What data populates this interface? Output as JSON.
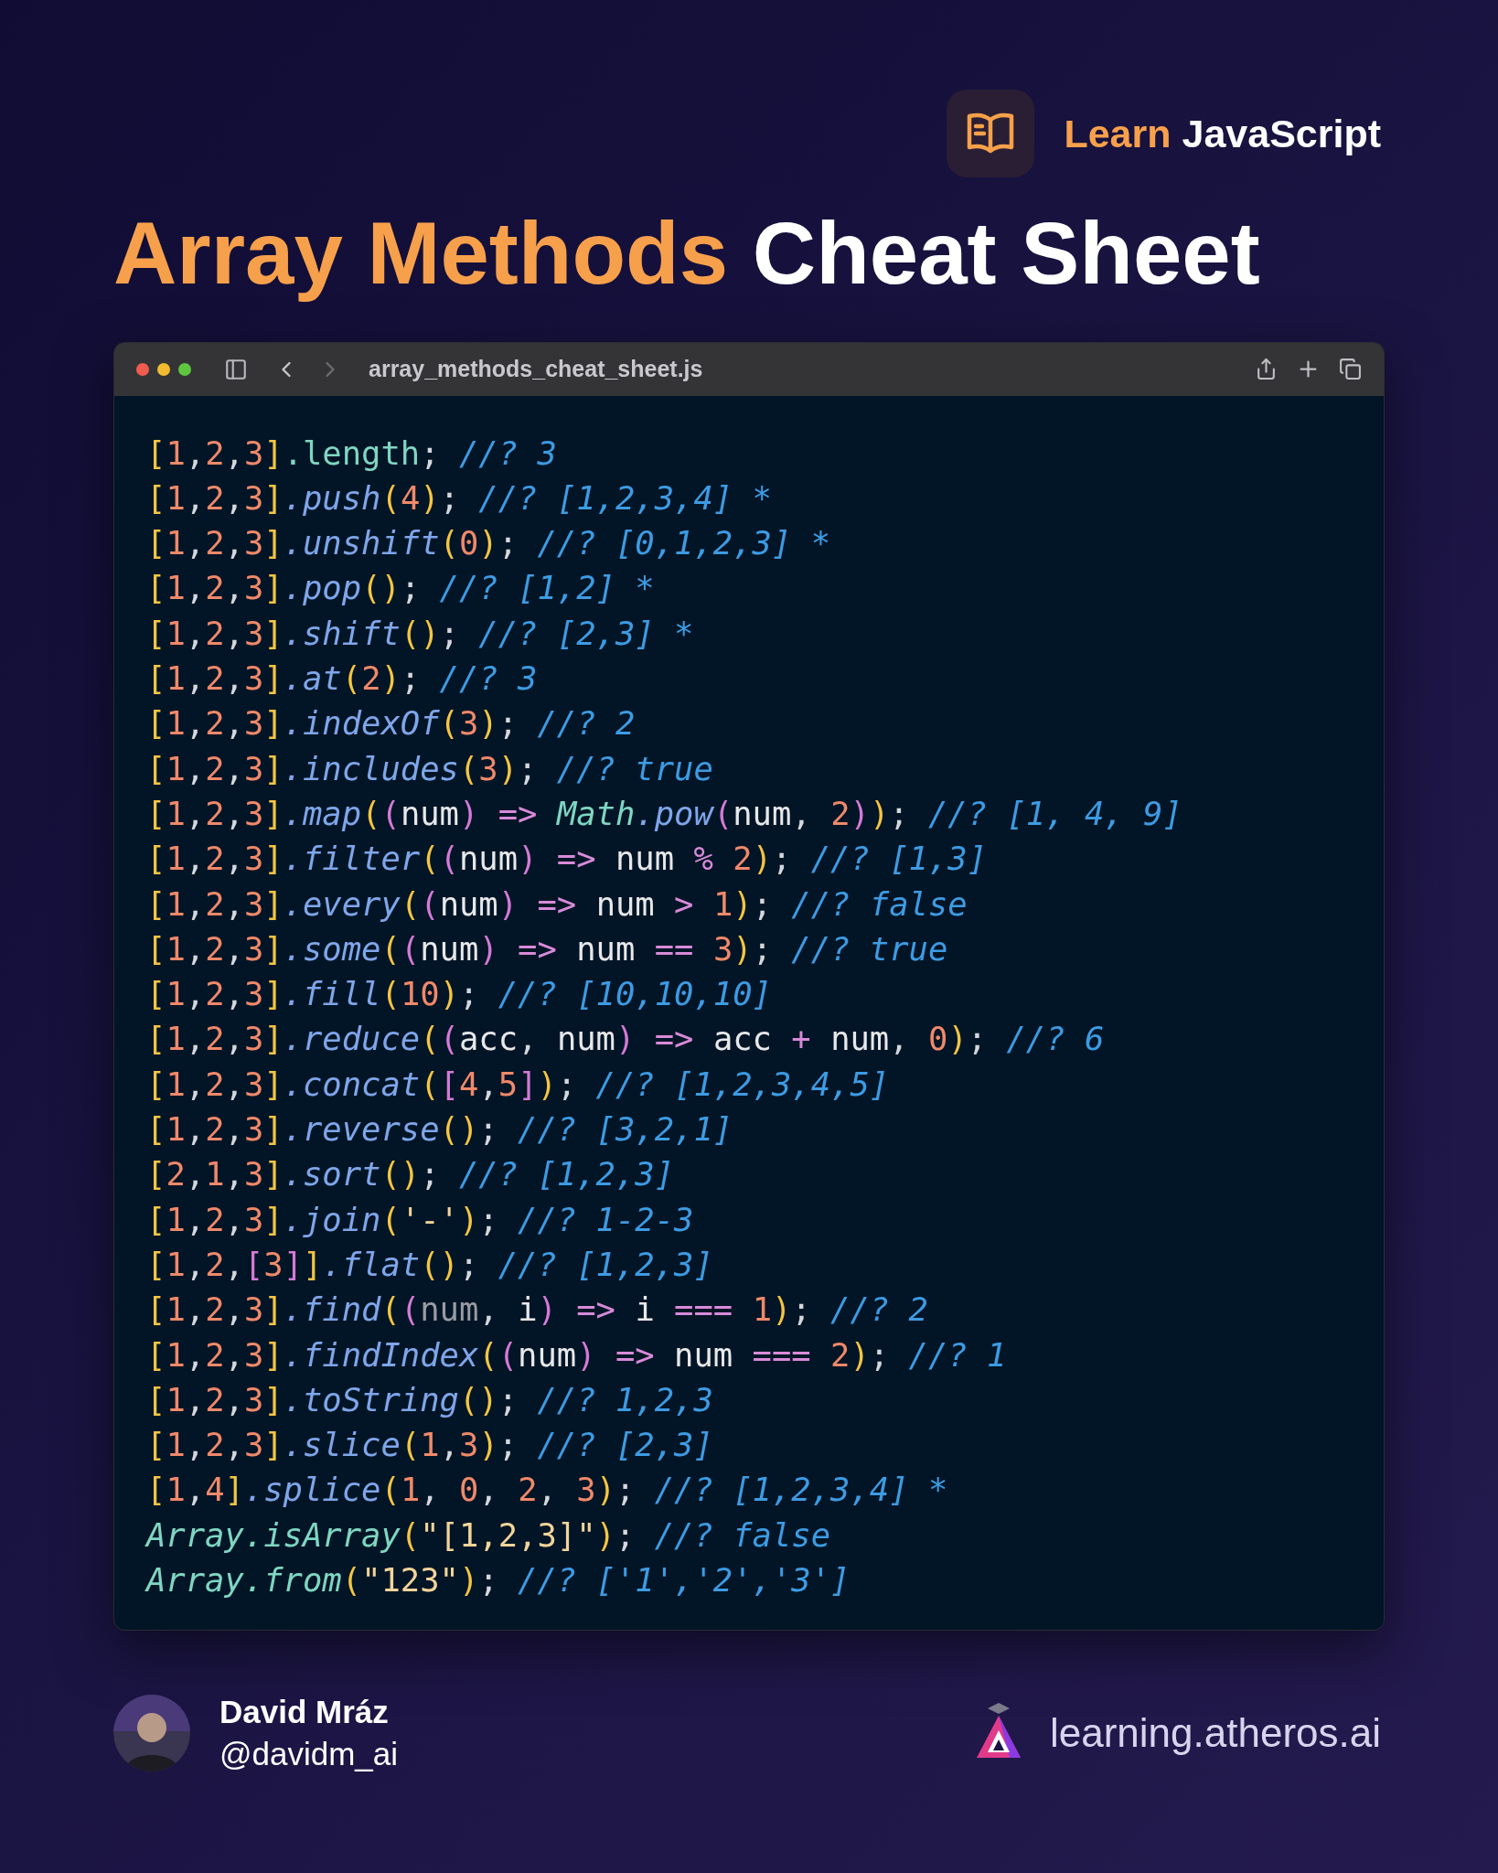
{
  "brand": {
    "highlight": "Learn",
    "rest": "JavaScript"
  },
  "title": {
    "highlight": "Array Methods",
    "rest": "Cheat Sheet"
  },
  "window": {
    "title": "array_methods_cheat_sheet.js"
  },
  "code_lines": [
    [
      {
        "text": "[",
        "kind": "br"
      },
      {
        "text": "1",
        "kind": "num"
      },
      {
        "text": ",",
        "kind": "p"
      },
      {
        "text": "2",
        "kind": "num"
      },
      {
        "text": ",",
        "kind": "p"
      },
      {
        "text": "3",
        "kind": "num"
      },
      {
        "text": "]",
        "kind": "br"
      },
      {
        "text": ".length",
        "kind": "prop"
      },
      {
        "text": ";",
        "kind": "p"
      },
      {
        "text": " //? 3",
        "kind": "c"
      }
    ],
    [
      {
        "text": "[",
        "kind": "br"
      },
      {
        "text": "1",
        "kind": "num"
      },
      {
        "text": ",",
        "kind": "p"
      },
      {
        "text": "2",
        "kind": "num"
      },
      {
        "text": ",",
        "kind": "p"
      },
      {
        "text": "3",
        "kind": "num"
      },
      {
        "text": "]",
        "kind": "br"
      },
      {
        "text": ".push",
        "kind": "m"
      },
      {
        "text": "(",
        "kind": "br"
      },
      {
        "text": "4",
        "kind": "num"
      },
      {
        "text": ")",
        "kind": "br"
      },
      {
        "text": ";",
        "kind": "p"
      },
      {
        "text": " //? [1,2,3,4] *",
        "kind": "c"
      }
    ],
    [
      {
        "text": "[",
        "kind": "br"
      },
      {
        "text": "1",
        "kind": "num"
      },
      {
        "text": ",",
        "kind": "p"
      },
      {
        "text": "2",
        "kind": "num"
      },
      {
        "text": ",",
        "kind": "p"
      },
      {
        "text": "3",
        "kind": "num"
      },
      {
        "text": "]",
        "kind": "br"
      },
      {
        "text": ".unshift",
        "kind": "m"
      },
      {
        "text": "(",
        "kind": "br"
      },
      {
        "text": "0",
        "kind": "num"
      },
      {
        "text": ")",
        "kind": "br"
      },
      {
        "text": ";",
        "kind": "p"
      },
      {
        "text": " //? [0,1,2,3] *",
        "kind": "c"
      }
    ],
    [
      {
        "text": "[",
        "kind": "br"
      },
      {
        "text": "1",
        "kind": "num"
      },
      {
        "text": ",",
        "kind": "p"
      },
      {
        "text": "2",
        "kind": "num"
      },
      {
        "text": ",",
        "kind": "p"
      },
      {
        "text": "3",
        "kind": "num"
      },
      {
        "text": "]",
        "kind": "br"
      },
      {
        "text": ".pop",
        "kind": "m"
      },
      {
        "text": "()",
        "kind": "br"
      },
      {
        "text": ";",
        "kind": "p"
      },
      {
        "text": " //? [1,2] *",
        "kind": "c"
      }
    ],
    [
      {
        "text": "[",
        "kind": "br"
      },
      {
        "text": "1",
        "kind": "num"
      },
      {
        "text": ",",
        "kind": "p"
      },
      {
        "text": "2",
        "kind": "num"
      },
      {
        "text": ",",
        "kind": "p"
      },
      {
        "text": "3",
        "kind": "num"
      },
      {
        "text": "]",
        "kind": "br"
      },
      {
        "text": ".shift",
        "kind": "m"
      },
      {
        "text": "()",
        "kind": "br"
      },
      {
        "text": ";",
        "kind": "p"
      },
      {
        "text": " //? [2,3] *",
        "kind": "c"
      }
    ],
    [
      {
        "text": "[",
        "kind": "br"
      },
      {
        "text": "1",
        "kind": "num"
      },
      {
        "text": ",",
        "kind": "p"
      },
      {
        "text": "2",
        "kind": "num"
      },
      {
        "text": ",",
        "kind": "p"
      },
      {
        "text": "3",
        "kind": "num"
      },
      {
        "text": "]",
        "kind": "br"
      },
      {
        "text": ".at",
        "kind": "m"
      },
      {
        "text": "(",
        "kind": "br"
      },
      {
        "text": "2",
        "kind": "num"
      },
      {
        "text": ")",
        "kind": "br"
      },
      {
        "text": ";",
        "kind": "p"
      },
      {
        "text": " //? 3",
        "kind": "c"
      }
    ],
    [
      {
        "text": "[",
        "kind": "br"
      },
      {
        "text": "1",
        "kind": "num"
      },
      {
        "text": ",",
        "kind": "p"
      },
      {
        "text": "2",
        "kind": "num"
      },
      {
        "text": ",",
        "kind": "p"
      },
      {
        "text": "3",
        "kind": "num"
      },
      {
        "text": "]",
        "kind": "br"
      },
      {
        "text": ".indexOf",
        "kind": "m"
      },
      {
        "text": "(",
        "kind": "br"
      },
      {
        "text": "3",
        "kind": "num"
      },
      {
        "text": ")",
        "kind": "br"
      },
      {
        "text": ";",
        "kind": "p"
      },
      {
        "text": " //? 2",
        "kind": "c"
      }
    ],
    [
      {
        "text": "[",
        "kind": "br"
      },
      {
        "text": "1",
        "kind": "num"
      },
      {
        "text": ",",
        "kind": "p"
      },
      {
        "text": "2",
        "kind": "num"
      },
      {
        "text": ",",
        "kind": "p"
      },
      {
        "text": "3",
        "kind": "num"
      },
      {
        "text": "]",
        "kind": "br"
      },
      {
        "text": ".includes",
        "kind": "m"
      },
      {
        "text": "(",
        "kind": "br"
      },
      {
        "text": "3",
        "kind": "num"
      },
      {
        "text": ")",
        "kind": "br"
      },
      {
        "text": ";",
        "kind": "p"
      },
      {
        "text": " //? true",
        "kind": "c"
      }
    ],
    [
      {
        "text": "[",
        "kind": "br"
      },
      {
        "text": "1",
        "kind": "num"
      },
      {
        "text": ",",
        "kind": "p"
      },
      {
        "text": "2",
        "kind": "num"
      },
      {
        "text": ",",
        "kind": "p"
      },
      {
        "text": "3",
        "kind": "num"
      },
      {
        "text": "]",
        "kind": "br"
      },
      {
        "text": ".map",
        "kind": "m"
      },
      {
        "text": "(",
        "kind": "br"
      },
      {
        "text": "(",
        "kind": "pp"
      },
      {
        "text": "num",
        "kind": "id"
      },
      {
        "text": ")",
        "kind": "pp"
      },
      {
        "text": " => ",
        "kind": "op"
      },
      {
        "text": "Math",
        "kind": "cls"
      },
      {
        "text": ".pow",
        "kind": "m"
      },
      {
        "text": "(",
        "kind": "pp"
      },
      {
        "text": "num",
        "kind": "id"
      },
      {
        "text": ", ",
        "kind": "p"
      },
      {
        "text": "2",
        "kind": "num"
      },
      {
        "text": ")",
        "kind": "pp"
      },
      {
        "text": ")",
        "kind": "br"
      },
      {
        "text": ";",
        "kind": "p"
      },
      {
        "text": " //? [1, 4, 9]",
        "kind": "c"
      }
    ],
    [
      {
        "text": "[",
        "kind": "br"
      },
      {
        "text": "1",
        "kind": "num"
      },
      {
        "text": ",",
        "kind": "p"
      },
      {
        "text": "2",
        "kind": "num"
      },
      {
        "text": ",",
        "kind": "p"
      },
      {
        "text": "3",
        "kind": "num"
      },
      {
        "text": "]",
        "kind": "br"
      },
      {
        "text": ".filter",
        "kind": "m"
      },
      {
        "text": "(",
        "kind": "br"
      },
      {
        "text": "(",
        "kind": "pp"
      },
      {
        "text": "num",
        "kind": "id"
      },
      {
        "text": ")",
        "kind": "pp"
      },
      {
        "text": " => ",
        "kind": "op"
      },
      {
        "text": "num",
        "kind": "id"
      },
      {
        "text": " % ",
        "kind": "op"
      },
      {
        "text": "2",
        "kind": "num"
      },
      {
        "text": ")",
        "kind": "br"
      },
      {
        "text": ";",
        "kind": "p"
      },
      {
        "text": " //? [1,3]",
        "kind": "c"
      }
    ],
    [
      {
        "text": "[",
        "kind": "br"
      },
      {
        "text": "1",
        "kind": "num"
      },
      {
        "text": ",",
        "kind": "p"
      },
      {
        "text": "2",
        "kind": "num"
      },
      {
        "text": ",",
        "kind": "p"
      },
      {
        "text": "3",
        "kind": "num"
      },
      {
        "text": "]",
        "kind": "br"
      },
      {
        "text": ".every",
        "kind": "m"
      },
      {
        "text": "(",
        "kind": "br"
      },
      {
        "text": "(",
        "kind": "pp"
      },
      {
        "text": "num",
        "kind": "id"
      },
      {
        "text": ")",
        "kind": "pp"
      },
      {
        "text": " => ",
        "kind": "op"
      },
      {
        "text": "num",
        "kind": "id"
      },
      {
        "text": " > ",
        "kind": "op"
      },
      {
        "text": "1",
        "kind": "num"
      },
      {
        "text": ")",
        "kind": "br"
      },
      {
        "text": ";",
        "kind": "p"
      },
      {
        "text": " //? false",
        "kind": "c"
      }
    ],
    [
      {
        "text": "[",
        "kind": "br"
      },
      {
        "text": "1",
        "kind": "num"
      },
      {
        "text": ",",
        "kind": "p"
      },
      {
        "text": "2",
        "kind": "num"
      },
      {
        "text": ",",
        "kind": "p"
      },
      {
        "text": "3",
        "kind": "num"
      },
      {
        "text": "]",
        "kind": "br"
      },
      {
        "text": ".some",
        "kind": "m"
      },
      {
        "text": "(",
        "kind": "br"
      },
      {
        "text": "(",
        "kind": "pp"
      },
      {
        "text": "num",
        "kind": "id"
      },
      {
        "text": ")",
        "kind": "pp"
      },
      {
        "text": " => ",
        "kind": "op"
      },
      {
        "text": "num",
        "kind": "id"
      },
      {
        "text": " == ",
        "kind": "op"
      },
      {
        "text": "3",
        "kind": "num"
      },
      {
        "text": ")",
        "kind": "br"
      },
      {
        "text": ";",
        "kind": "p"
      },
      {
        "text": " //? true",
        "kind": "c"
      }
    ],
    [
      {
        "text": "[",
        "kind": "br"
      },
      {
        "text": "1",
        "kind": "num"
      },
      {
        "text": ",",
        "kind": "p"
      },
      {
        "text": "2",
        "kind": "num"
      },
      {
        "text": ",",
        "kind": "p"
      },
      {
        "text": "3",
        "kind": "num"
      },
      {
        "text": "]",
        "kind": "br"
      },
      {
        "text": ".fill",
        "kind": "m"
      },
      {
        "text": "(",
        "kind": "br"
      },
      {
        "text": "10",
        "kind": "num"
      },
      {
        "text": ")",
        "kind": "br"
      },
      {
        "text": ";",
        "kind": "p"
      },
      {
        "text": " //? [10,10,10]",
        "kind": "c"
      }
    ],
    [
      {
        "text": "[",
        "kind": "br"
      },
      {
        "text": "1",
        "kind": "num"
      },
      {
        "text": ",",
        "kind": "p"
      },
      {
        "text": "2",
        "kind": "num"
      },
      {
        "text": ",",
        "kind": "p"
      },
      {
        "text": "3",
        "kind": "num"
      },
      {
        "text": "]",
        "kind": "br"
      },
      {
        "text": ".reduce",
        "kind": "m"
      },
      {
        "text": "(",
        "kind": "br"
      },
      {
        "text": "(",
        "kind": "pp"
      },
      {
        "text": "acc",
        "kind": "id"
      },
      {
        "text": ", ",
        "kind": "p"
      },
      {
        "text": "num",
        "kind": "id"
      },
      {
        "text": ")",
        "kind": "pp"
      },
      {
        "text": " => ",
        "kind": "op"
      },
      {
        "text": "acc",
        "kind": "id"
      },
      {
        "text": " + ",
        "kind": "op"
      },
      {
        "text": "num",
        "kind": "id"
      },
      {
        "text": ", ",
        "kind": "p"
      },
      {
        "text": "0",
        "kind": "num"
      },
      {
        "text": ")",
        "kind": "br"
      },
      {
        "text": ";",
        "kind": "p"
      },
      {
        "text": " //? 6",
        "kind": "c"
      }
    ],
    [
      {
        "text": "[",
        "kind": "br"
      },
      {
        "text": "1",
        "kind": "num"
      },
      {
        "text": ",",
        "kind": "p"
      },
      {
        "text": "2",
        "kind": "num"
      },
      {
        "text": ",",
        "kind": "p"
      },
      {
        "text": "3",
        "kind": "num"
      },
      {
        "text": "]",
        "kind": "br"
      },
      {
        "text": ".concat",
        "kind": "m"
      },
      {
        "text": "(",
        "kind": "br"
      },
      {
        "text": "[",
        "kind": "pp"
      },
      {
        "text": "4",
        "kind": "num"
      },
      {
        "text": ",",
        "kind": "p"
      },
      {
        "text": "5",
        "kind": "num"
      },
      {
        "text": "]",
        "kind": "pp"
      },
      {
        "text": ")",
        "kind": "br"
      },
      {
        "text": ";",
        "kind": "p"
      },
      {
        "text": " //? [1,2,3,4,5]",
        "kind": "c"
      }
    ],
    [
      {
        "text": "[",
        "kind": "br"
      },
      {
        "text": "1",
        "kind": "num"
      },
      {
        "text": ",",
        "kind": "p"
      },
      {
        "text": "2",
        "kind": "num"
      },
      {
        "text": ",",
        "kind": "p"
      },
      {
        "text": "3",
        "kind": "num"
      },
      {
        "text": "]",
        "kind": "br"
      },
      {
        "text": ".reverse",
        "kind": "m"
      },
      {
        "text": "()",
        "kind": "br"
      },
      {
        "text": ";",
        "kind": "p"
      },
      {
        "text": " //? [3,2,1]",
        "kind": "c"
      }
    ],
    [
      {
        "text": "[",
        "kind": "br"
      },
      {
        "text": "2",
        "kind": "num"
      },
      {
        "text": ",",
        "kind": "p"
      },
      {
        "text": "1",
        "kind": "num"
      },
      {
        "text": ",",
        "kind": "p"
      },
      {
        "text": "3",
        "kind": "num"
      },
      {
        "text": "]",
        "kind": "br"
      },
      {
        "text": ".sort",
        "kind": "m"
      },
      {
        "text": "()",
        "kind": "br"
      },
      {
        "text": ";",
        "kind": "p"
      },
      {
        "text": " //? [1,2,3]",
        "kind": "c"
      }
    ],
    [
      {
        "text": "[",
        "kind": "br"
      },
      {
        "text": "1",
        "kind": "num"
      },
      {
        "text": ",",
        "kind": "p"
      },
      {
        "text": "2",
        "kind": "num"
      },
      {
        "text": ",",
        "kind": "p"
      },
      {
        "text": "3",
        "kind": "num"
      },
      {
        "text": "]",
        "kind": "br"
      },
      {
        "text": ".join",
        "kind": "m"
      },
      {
        "text": "(",
        "kind": "br"
      },
      {
        "text": "'-'",
        "kind": "str"
      },
      {
        "text": ")",
        "kind": "br"
      },
      {
        "text": ";",
        "kind": "p"
      },
      {
        "text": " //? 1-2-3",
        "kind": "c"
      }
    ],
    [
      {
        "text": "[",
        "kind": "br"
      },
      {
        "text": "1",
        "kind": "num"
      },
      {
        "text": ",",
        "kind": "p"
      },
      {
        "text": "2",
        "kind": "num"
      },
      {
        "text": ",",
        "kind": "p"
      },
      {
        "text": "[",
        "kind": "pp"
      },
      {
        "text": "3",
        "kind": "num"
      },
      {
        "text": "]",
        "kind": "pp"
      },
      {
        "text": "]",
        "kind": "br"
      },
      {
        "text": ".flat",
        "kind": "m"
      },
      {
        "text": "()",
        "kind": "br"
      },
      {
        "text": ";",
        "kind": "p"
      },
      {
        "text": " //? [1,2,3]",
        "kind": "c"
      }
    ],
    [
      {
        "text": "[",
        "kind": "br"
      },
      {
        "text": "1",
        "kind": "num"
      },
      {
        "text": ",",
        "kind": "p"
      },
      {
        "text": "2",
        "kind": "num"
      },
      {
        "text": ",",
        "kind": "p"
      },
      {
        "text": "3",
        "kind": "num"
      },
      {
        "text": "]",
        "kind": "br"
      },
      {
        "text": ".find",
        "kind": "m"
      },
      {
        "text": "(",
        "kind": "br"
      },
      {
        "text": "(",
        "kind": "pp"
      },
      {
        "text": "num",
        "kind": "dim"
      },
      {
        "text": ", ",
        "kind": "p"
      },
      {
        "text": "i",
        "kind": "id"
      },
      {
        "text": ")",
        "kind": "pp"
      },
      {
        "text": " => ",
        "kind": "op"
      },
      {
        "text": "i",
        "kind": "id"
      },
      {
        "text": " === ",
        "kind": "op"
      },
      {
        "text": "1",
        "kind": "num"
      },
      {
        "text": ")",
        "kind": "br"
      },
      {
        "text": ";",
        "kind": "p"
      },
      {
        "text": " //? 2",
        "kind": "c"
      }
    ],
    [
      {
        "text": "[",
        "kind": "br"
      },
      {
        "text": "1",
        "kind": "num"
      },
      {
        "text": ",",
        "kind": "p"
      },
      {
        "text": "2",
        "kind": "num"
      },
      {
        "text": ",",
        "kind": "p"
      },
      {
        "text": "3",
        "kind": "num"
      },
      {
        "text": "]",
        "kind": "br"
      },
      {
        "text": ".findIndex",
        "kind": "m"
      },
      {
        "text": "(",
        "kind": "br"
      },
      {
        "text": "(",
        "kind": "pp"
      },
      {
        "text": "num",
        "kind": "id"
      },
      {
        "text": ")",
        "kind": "pp"
      },
      {
        "text": " => ",
        "kind": "op"
      },
      {
        "text": "num",
        "kind": "id"
      },
      {
        "text": " === ",
        "kind": "op"
      },
      {
        "text": "2",
        "kind": "num"
      },
      {
        "text": ")",
        "kind": "br"
      },
      {
        "text": ";",
        "kind": "p"
      },
      {
        "text": " //? 1",
        "kind": "c"
      }
    ],
    [
      {
        "text": "[",
        "kind": "br"
      },
      {
        "text": "1",
        "kind": "num"
      },
      {
        "text": ",",
        "kind": "p"
      },
      {
        "text": "2",
        "kind": "num"
      },
      {
        "text": ",",
        "kind": "p"
      },
      {
        "text": "3",
        "kind": "num"
      },
      {
        "text": "]",
        "kind": "br"
      },
      {
        "text": ".toString",
        "kind": "m"
      },
      {
        "text": "()",
        "kind": "br"
      },
      {
        "text": ";",
        "kind": "p"
      },
      {
        "text": " //? 1,2,3",
        "kind": "c"
      }
    ],
    [
      {
        "text": "[",
        "kind": "br"
      },
      {
        "text": "1",
        "kind": "num"
      },
      {
        "text": ",",
        "kind": "p"
      },
      {
        "text": "2",
        "kind": "num"
      },
      {
        "text": ",",
        "kind": "p"
      },
      {
        "text": "3",
        "kind": "num"
      },
      {
        "text": "]",
        "kind": "br"
      },
      {
        "text": ".slice",
        "kind": "m"
      },
      {
        "text": "(",
        "kind": "br"
      },
      {
        "text": "1",
        "kind": "num"
      },
      {
        "text": ",",
        "kind": "p"
      },
      {
        "text": "3",
        "kind": "num"
      },
      {
        "text": ")",
        "kind": "br"
      },
      {
        "text": ";",
        "kind": "p"
      },
      {
        "text": " //? [2,3]",
        "kind": "c"
      }
    ],
    [
      {
        "text": "[",
        "kind": "br"
      },
      {
        "text": "1",
        "kind": "num"
      },
      {
        "text": ",",
        "kind": "p"
      },
      {
        "text": "4",
        "kind": "num"
      },
      {
        "text": "]",
        "kind": "br"
      },
      {
        "text": ".splice",
        "kind": "m"
      },
      {
        "text": "(",
        "kind": "br"
      },
      {
        "text": "1",
        "kind": "num"
      },
      {
        "text": ", ",
        "kind": "p"
      },
      {
        "text": "0",
        "kind": "num"
      },
      {
        "text": ", ",
        "kind": "p"
      },
      {
        "text": "2",
        "kind": "num"
      },
      {
        "text": ", ",
        "kind": "p"
      },
      {
        "text": "3",
        "kind": "num"
      },
      {
        "text": ")",
        "kind": "br"
      },
      {
        "text": ";",
        "kind": "p"
      },
      {
        "text": " //? [1,2,3,4] *",
        "kind": "c"
      }
    ],
    [
      {
        "text": "Array",
        "kind": "cls"
      },
      {
        "text": ".isArray",
        "kind": "cls"
      },
      {
        "text": "(",
        "kind": "br"
      },
      {
        "text": "\"[1,2,3]\"",
        "kind": "str"
      },
      {
        "text": ")",
        "kind": "br"
      },
      {
        "text": ";",
        "kind": "p"
      },
      {
        "text": " //? false",
        "kind": "c"
      }
    ],
    [
      {
        "text": "Array",
        "kind": "cls"
      },
      {
        "text": ".from",
        "kind": "cls"
      },
      {
        "text": "(",
        "kind": "br"
      },
      {
        "text": "\"123\"",
        "kind": "str"
      },
      {
        "text": ")",
        "kind": "br"
      },
      {
        "text": ";",
        "kind": "p"
      },
      {
        "text": " //? ['1','2','3']",
        "kind": "c"
      }
    ]
  ],
  "author": {
    "name": "David Mráz",
    "handle": "@davidm_ai"
  },
  "site": "learning.atheros.ai"
}
